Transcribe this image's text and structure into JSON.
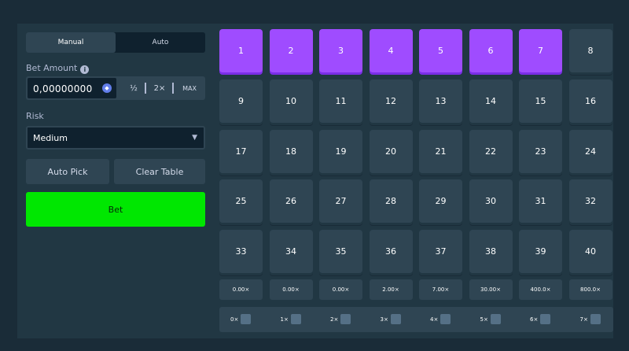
{
  "modes": {
    "manual": "Manual",
    "auto": "Auto",
    "active": "manual"
  },
  "bet_amount": {
    "label": "Bet Amount",
    "info_icon": "i",
    "value": "0,00000000",
    "currency_icon": "ethereum-coin-icon",
    "half_label": "½",
    "double_label": "2×",
    "max_label": "MAX"
  },
  "risk": {
    "label": "Risk",
    "value": "Medium",
    "chevron": "⌄"
  },
  "actions": {
    "auto_pick": "Auto Pick",
    "clear_table": "Clear Table",
    "bet": "Bet"
  },
  "tiles": [
    "1",
    "2",
    "3",
    "4",
    "5",
    "6",
    "7",
    "8",
    "9",
    "10",
    "11",
    "12",
    "13",
    "14",
    "15",
    "16",
    "17",
    "18",
    "19",
    "20",
    "21",
    "22",
    "23",
    "24",
    "25",
    "26",
    "27",
    "28",
    "29",
    "30",
    "31",
    "32",
    "33",
    "34",
    "35",
    "36",
    "37",
    "38",
    "39",
    "40"
  ],
  "selected_tiles": [
    1,
    2,
    3,
    4,
    5,
    6,
    7
  ],
  "payouts": [
    "0.00×",
    "0.00×",
    "0.00×",
    "2.00×",
    "7.00×",
    "30.00×",
    "400.0×",
    "800.0×"
  ],
  "hits": [
    "0×",
    "1×",
    "2×",
    "3×",
    "4×",
    "5×",
    "6×",
    "7×"
  ],
  "colors": {
    "background": "#1a2c38",
    "panel": "#213743",
    "tile": "#2f4553",
    "selected_tile": "#9f4cff",
    "bet_button": "#00e701"
  }
}
